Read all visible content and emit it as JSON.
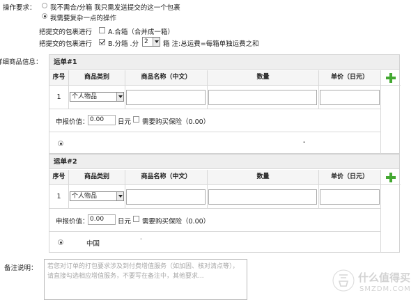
{
  "operation": {
    "label": "操作要求：",
    "option_no_merge": "我不需合/分箱 我只需发送提交的这一个包裹",
    "option_complex": "我需要复杂一点的操作",
    "merge_row": {
      "prefix": "把提交的包裹进行",
      "label": "A.合箱（合并成一箱）",
      "checked": false
    },
    "split_row": {
      "prefix": "把提交的包裹进行",
      "label": "B.分箱 .分",
      "count": "2",
      "suffix": "箱 注:总运费=每箱单独运费之和",
      "checked": true
    }
  },
  "details_label": "详细商品信息：",
  "table_headers": {
    "index": "序号",
    "category": "商品类别",
    "name": "商品名称（中文）",
    "quantity": "数量",
    "price": "单价（日元）"
  },
  "shipments": [
    {
      "title": "运单#1",
      "row": {
        "index": "1",
        "category": "个人物品",
        "name": "",
        "quantity": "",
        "price": ""
      },
      "declared": {
        "label": "申报价值：",
        "value": "0.00",
        "unit": "日元",
        "insurance_label": "需要购买保险（0.00）"
      },
      "address": {
        "country": "",
        "mark": "-"
      }
    },
    {
      "title": "运单#2",
      "row": {
        "index": "1",
        "category": "个人物品",
        "name": "",
        "quantity": "",
        "price": ""
      },
      "declared": {
        "label": "申报价值：",
        "value": "0.00",
        "unit": "日元",
        "insurance_label": "需要购买保险（0.00）"
      },
      "address": {
        "country": "中国",
        "mark": "'"
      }
    }
  ],
  "remarks": {
    "label": "备注说明：",
    "placeholder": "若您对订单的打包要求涉及到付费增值服务（如加固、核对清点等），请直接勾选相应增值服务，不要写在备注中，其他要求..."
  },
  "watermark": {
    "text": "什么值得买",
    "subtext": "SMZDM.COM",
    "logo": "smzdm-logo"
  },
  "colors": {
    "accent_green": "#44a832",
    "header_gray": "#eeeeee"
  }
}
